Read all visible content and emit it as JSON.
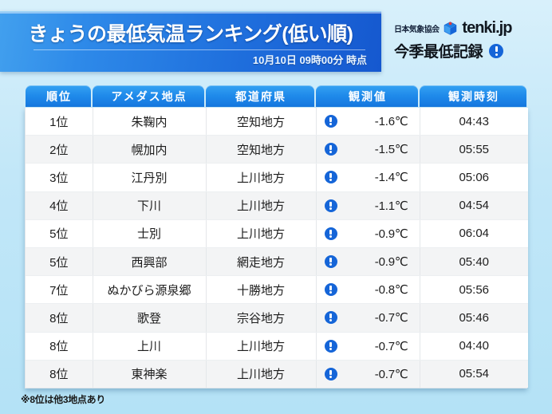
{
  "header": {
    "title": "きょうの最低気温ランキング(低い順)",
    "timestamp": "10月10日  09時00分 時点",
    "association": "日本気象協会",
    "brand": "tenki.jp",
    "brand_logo_icon": "tenki-cube-icon",
    "record_badge_label": "今季最低記録",
    "record_badge_icon": "exclamation-circle-icon"
  },
  "table": {
    "columns": [
      "順位",
      "アメダス地点",
      "都道府県",
      "観測値",
      "観測時刻"
    ],
    "rows": [
      {
        "rank": "1位",
        "point": "朱鞠内",
        "pref": "空知地方",
        "flag": "exclamation-circle-icon",
        "value": "-1.6℃",
        "time": "04:43"
      },
      {
        "rank": "2位",
        "point": "幌加内",
        "pref": "空知地方",
        "flag": "exclamation-circle-icon",
        "value": "-1.5℃",
        "time": "05:55"
      },
      {
        "rank": "3位",
        "point": "江丹別",
        "pref": "上川地方",
        "flag": "exclamation-circle-icon",
        "value": "-1.4℃",
        "time": "05:06"
      },
      {
        "rank": "4位",
        "point": "下川",
        "pref": "上川地方",
        "flag": "exclamation-circle-icon",
        "value": "-1.1℃",
        "time": "04:54"
      },
      {
        "rank": "5位",
        "point": "士別",
        "pref": "上川地方",
        "flag": "exclamation-circle-icon",
        "value": "-0.9℃",
        "time": "06:04"
      },
      {
        "rank": "5位",
        "point": "西興部",
        "pref": "網走地方",
        "flag": "exclamation-circle-icon",
        "value": "-0.9℃",
        "time": "05:40"
      },
      {
        "rank": "7位",
        "point": "ぬかびら源泉郷",
        "pref": "十勝地方",
        "flag": "exclamation-circle-icon",
        "value": "-0.8℃",
        "time": "05:56"
      },
      {
        "rank": "8位",
        "point": "歌登",
        "pref": "宗谷地方",
        "flag": "exclamation-circle-icon",
        "value": "-0.7℃",
        "time": "05:46"
      },
      {
        "rank": "8位",
        "point": "上川",
        "pref": "上川地方",
        "flag": "exclamation-circle-icon",
        "value": "-0.7℃",
        "time": "04:40"
      },
      {
        "rank": "8位",
        "point": "東神楽",
        "pref": "上川地方",
        "flag": "exclamation-circle-icon",
        "value": "-0.7℃",
        "time": "05:54"
      }
    ]
  },
  "footnote": "※8位は他3地点あり",
  "colors": {
    "page_background": "#c2e7f8",
    "title_plate_left": "#42a0ee",
    "title_plate_right": "#1558cf",
    "header_cell": "#1f8aea",
    "alert_blue": "#1565d8",
    "row_alt": "#f3f4f5",
    "text_dark": "#1d1d1d"
  }
}
